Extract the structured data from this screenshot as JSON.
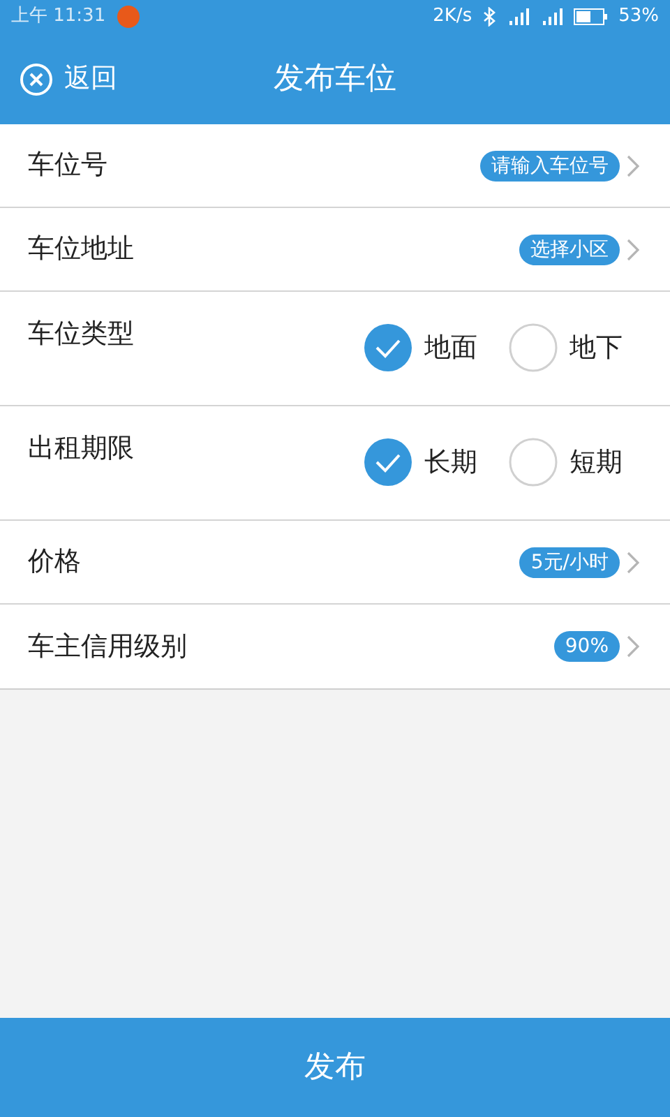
{
  "status_bar": {
    "time": "上午 11:31",
    "speed": "2K/s",
    "battery": "53%"
  },
  "header": {
    "back": "返回",
    "title": "发布车位"
  },
  "rows": [
    {
      "kind": "value",
      "label": "车位号",
      "value": "请输入车位号"
    },
    {
      "kind": "value",
      "label": "车位地址",
      "value": "选择小区"
    },
    {
      "kind": "choice",
      "label": "车位类型",
      "options": [
        {
          "label": "地面",
          "selected": true
        },
        {
          "label": "地下",
          "selected": false
        }
      ]
    },
    {
      "kind": "choice",
      "label": "出租期限",
      "options": [
        {
          "label": "长期",
          "selected": true
        },
        {
          "label": "短期",
          "selected": false
        }
      ]
    },
    {
      "kind": "value",
      "label": "价格",
      "value": "5元/小时"
    },
    {
      "kind": "value",
      "label": "车主信用级别",
      "value": "90%"
    }
  ],
  "submit": "发布"
}
